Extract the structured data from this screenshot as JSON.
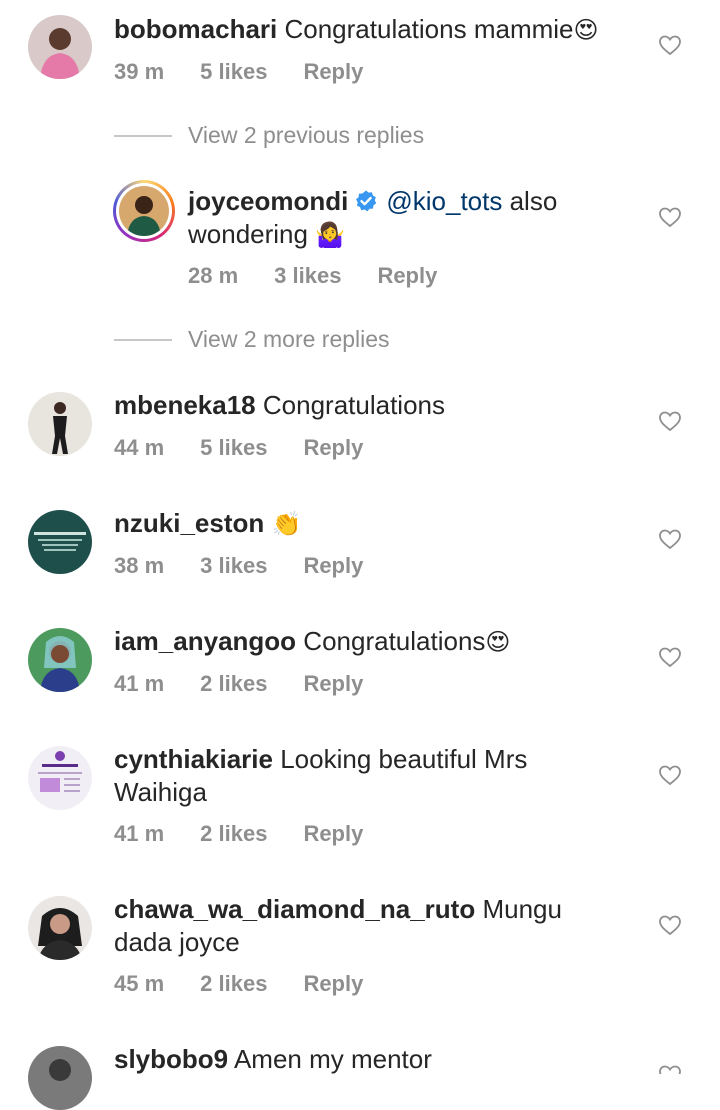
{
  "comments": [
    {
      "username": "bobomachari",
      "text": "Congratulations mammie",
      "emoji": "😍",
      "time": "39 m",
      "likes": "5 likes",
      "reply": "Reply",
      "avatar_color": "#c78aa8"
    },
    {
      "username": "mbeneka18",
      "text": "Congratulations",
      "emoji": "",
      "time": "44 m",
      "likes": "5 likes",
      "reply": "Reply",
      "avatar_color": "#b9b3a6"
    },
    {
      "username": "nzuki_eston",
      "text": "",
      "emoji": "👏",
      "time": "38 m",
      "likes": "3 likes",
      "reply": "Reply",
      "avatar_color": "#1f4f4a"
    },
    {
      "username": "iam_anyangoo",
      "text": "Congratulations",
      "emoji": "😍",
      "time": "41 m",
      "likes": "2 likes",
      "reply": "Reply",
      "avatar_color": "#3f8a55"
    },
    {
      "username": "cynthiakiarie",
      "text": "Looking beautiful Mrs Waihiga",
      "emoji": "",
      "time": "41 m",
      "likes": "2 likes",
      "reply": "Reply",
      "avatar_color": "#e7e2ee"
    },
    {
      "username": "chawa_wa_diamond_na_ruto",
      "text": "Mungu dada joyce",
      "emoji": "",
      "time": "45 m",
      "likes": "2 likes",
      "reply": "Reply",
      "avatar_color": "#2c2c2c"
    },
    {
      "username": "slybobo9",
      "text": "Amen my mentor",
      "emoji": "",
      "time": "",
      "likes": "",
      "reply": "",
      "avatar_color": "#6a6a6a"
    }
  ],
  "reply_thread": {
    "view_previous": "View 2 previous replies",
    "view_more": "View 2 more replies",
    "reply": {
      "username": "joyceomondi",
      "mention": "@kio_tots",
      "text_after_mention": "also",
      "text_line2": "wondering",
      "emoji": "🤷‍♀️",
      "time": "28 m",
      "likes": "3 likes",
      "reply": "Reply",
      "verified": true,
      "verified_color": "#3897f0"
    }
  },
  "icons": {
    "like": "heart-outline-icon",
    "verified": "verified-badge-icon"
  }
}
